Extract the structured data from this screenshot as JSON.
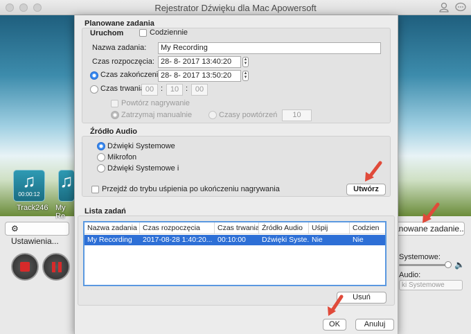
{
  "window": {
    "title": "Rejestrator Dźwięku dla Mac Apowersoft"
  },
  "main": {
    "tracks": [
      {
        "name": "Track246",
        "duration": "00:00:12"
      },
      {
        "name": "My Re",
        "duration": ""
      }
    ],
    "settings_label": "Ustawienia...",
    "schedule_label": "anowane zadanie...",
    "system_sound_label": "Systemowe:",
    "audio_label": "Audio:",
    "audio_select": "ki Systemowe"
  },
  "dialog": {
    "title": "Planowane zadania",
    "run": {
      "title": "Uruchom",
      "daily_label": "Codziennie",
      "task_name_label": "Nazwa zadania:",
      "task_name_value": "My Recording",
      "start_label": "Czas rozpoczęcia:",
      "start_value": "28-  8- 2017  13:40:20",
      "end_label": "Czas zakończenia:",
      "end_value": "28-  8- 2017  13:50:20",
      "duration_label": "Czas trwania:",
      "duration_h": "00",
      "duration_m": "10",
      "duration_s": "00",
      "repeat_label": "Powtórz nagrywanie",
      "stop_manual_label": "Zatrzymaj manualnie",
      "repeat_times_label": "Czasy powtórzeń",
      "repeat_times_value": "10"
    },
    "audio_source": {
      "title": "Źródło Audio",
      "options": [
        "Dźwięki Systemowe",
        "Mikrofon",
        "Dźwięki Systemowe i"
      ],
      "selected_index": 0,
      "sleep_label": "Przejdź do trybu uśpienia po ukończeniu nagrywania",
      "create_label": "Utwórz"
    },
    "task_list": {
      "title": "Lista zadań",
      "columns": [
        "Nazwa zadania",
        "Czas rozpoczęcia",
        "Czas trwania",
        "Źródło Audio",
        "Uśpij",
        "Codzien"
      ],
      "rows": [
        [
          "My Recording",
          "2017-08-28 1:40:20...",
          "00:10:00",
          "Dźwięki Syste...",
          "Nie",
          "Nie"
        ]
      ],
      "delete_label": "Usuń"
    },
    "ok_label": "OK",
    "cancel_label": "Anuluj"
  },
  "colors": {
    "accent": "#2d6fd6",
    "arrow": "#e04a3a"
  }
}
